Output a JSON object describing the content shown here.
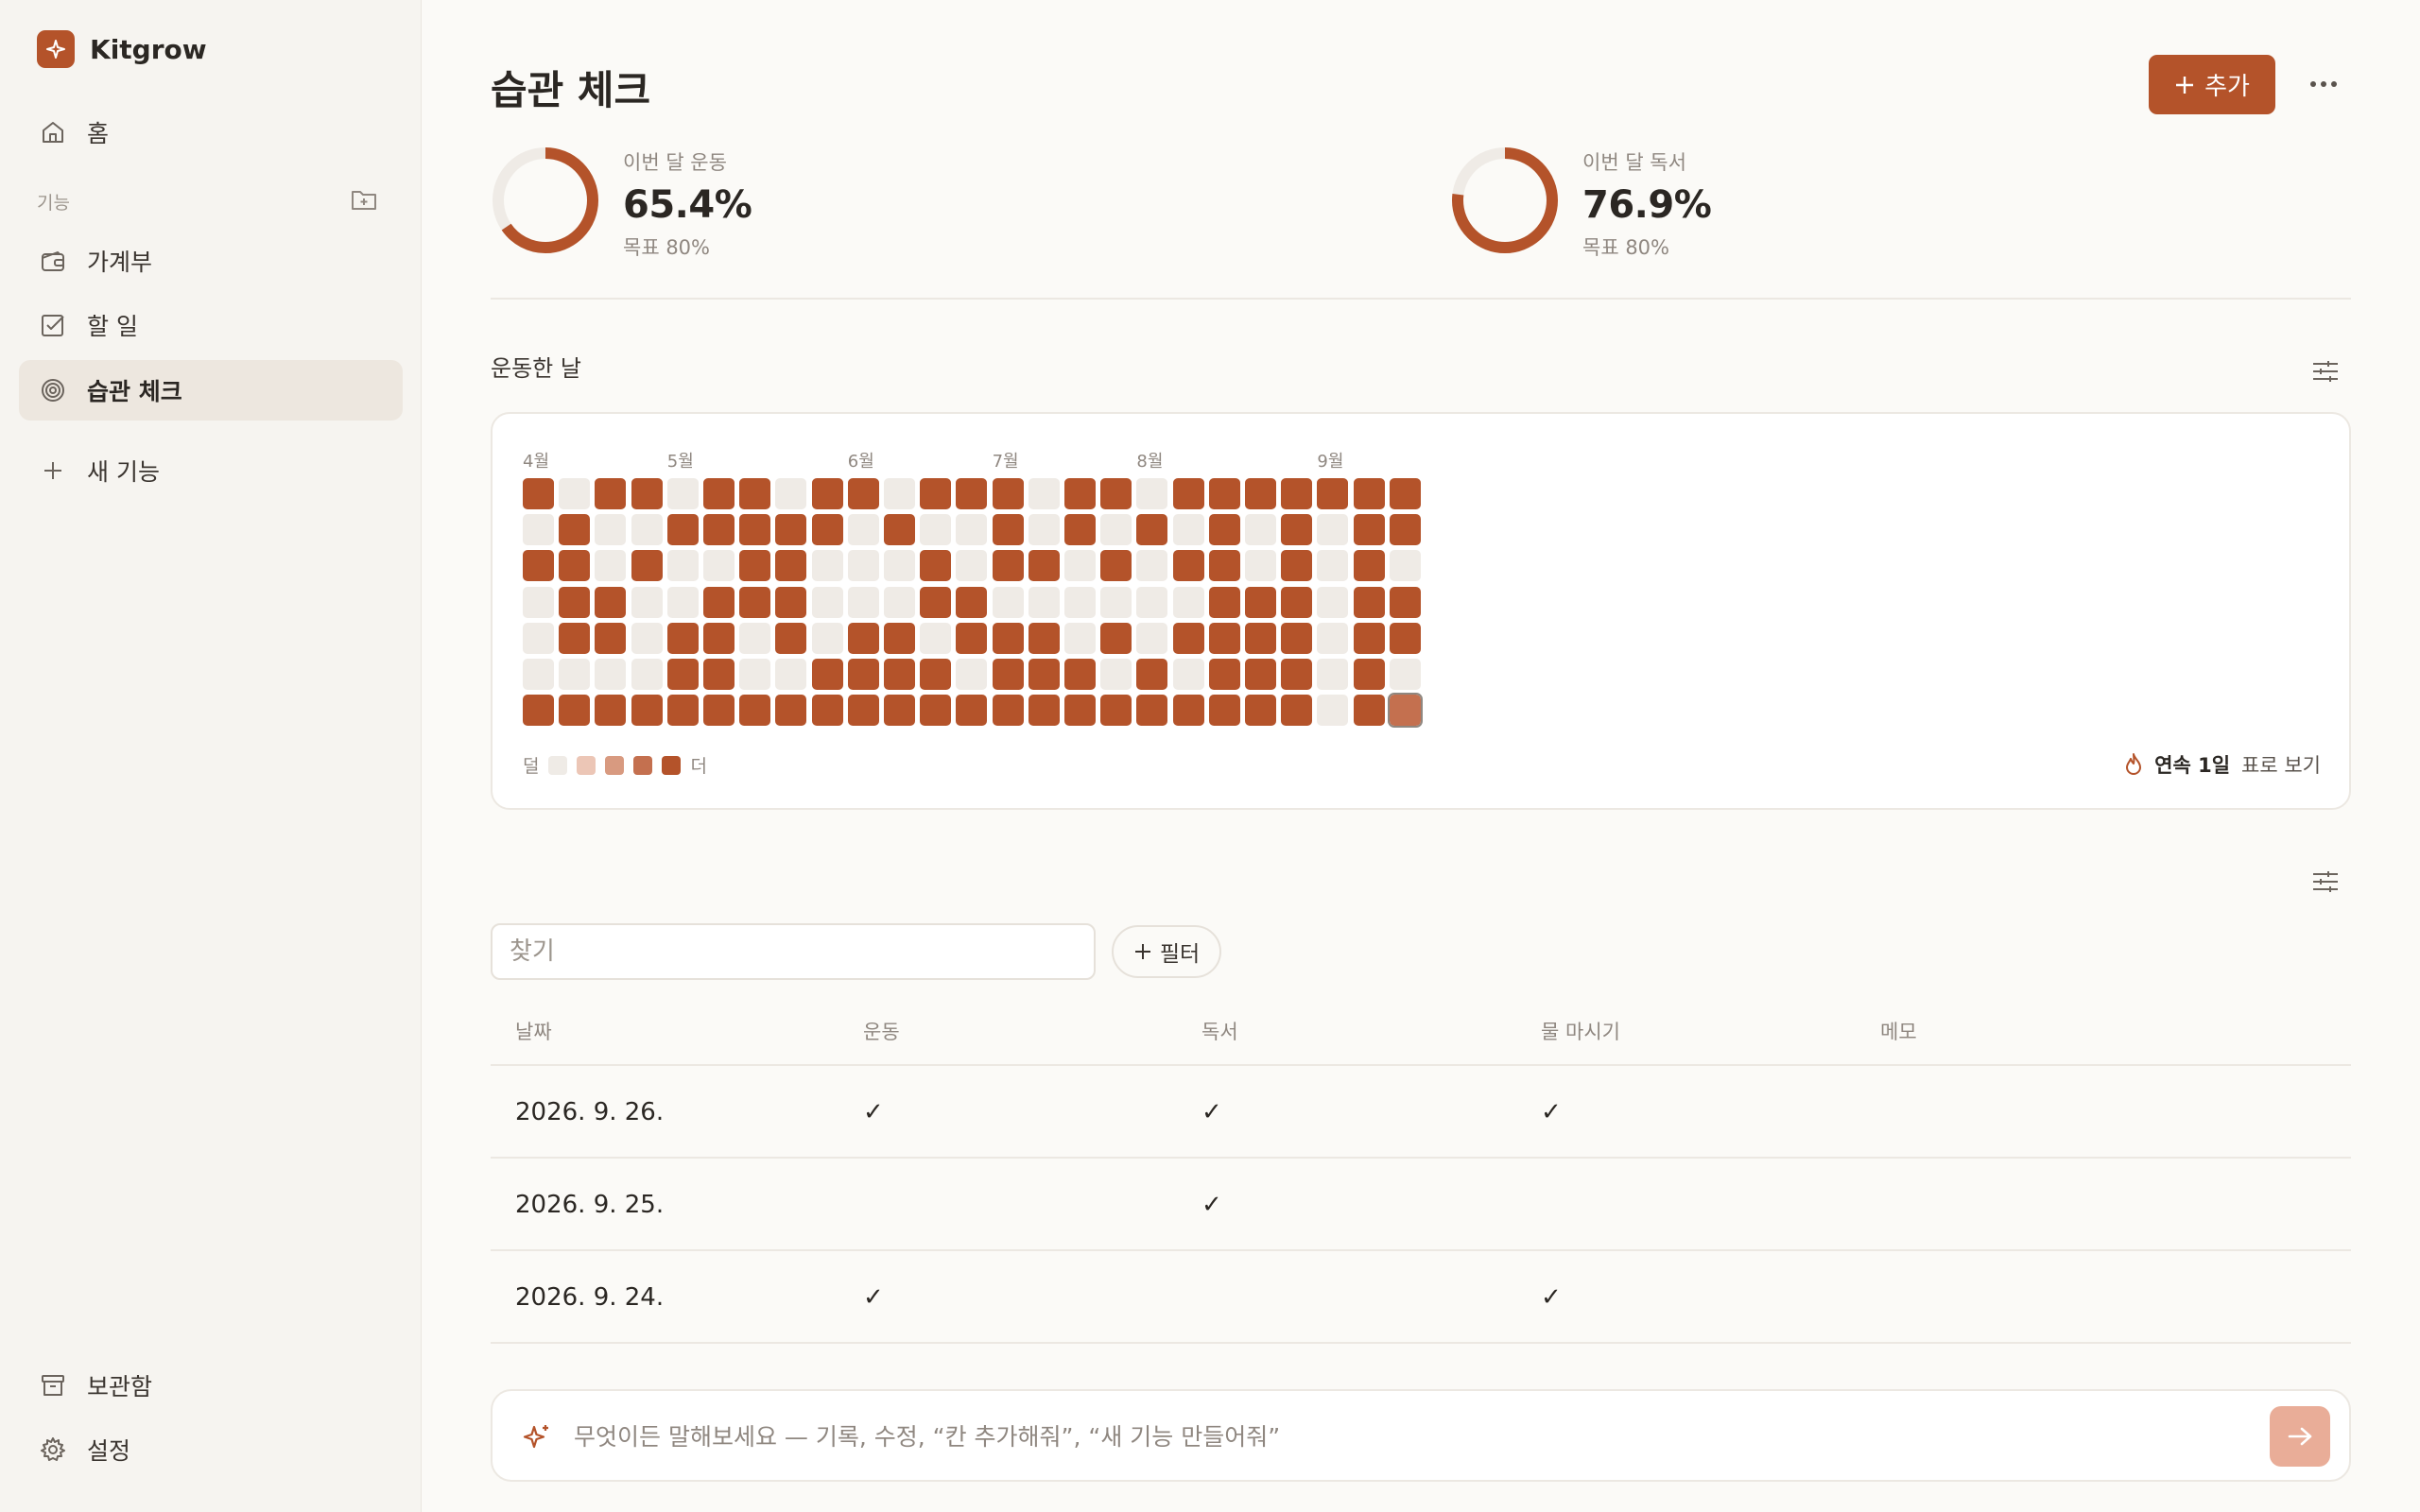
{
  "app": {
    "name": "Kitgrow"
  },
  "sidebar": {
    "home_label": "홈",
    "section_label": "기능",
    "items": [
      {
        "label": "가계부",
        "icon": "wallet-icon"
      },
      {
        "label": "할 일",
        "icon": "checkbox-icon"
      },
      {
        "label": "습관 체크",
        "icon": "target-icon",
        "active": true
      }
    ],
    "new_feature_label": "새 기능",
    "archive_label": "보관함",
    "settings_label": "설정"
  },
  "page": {
    "title": "습관 체크",
    "add_label": "추가"
  },
  "stats": [
    {
      "label": "이번 달 운동",
      "value": "65.4%",
      "target": "목표 80%",
      "fraction": 0.654
    },
    {
      "label": "이번 달 독서",
      "value": "76.9%",
      "target": "목표 80%",
      "fraction": 0.769
    }
  ],
  "heatmap": {
    "title": "운동한 날",
    "months": [
      {
        "label": "4월",
        "col": 0
      },
      {
        "label": "5월",
        "col": 4
      },
      {
        "label": "6월",
        "col": 9
      },
      {
        "label": "7월",
        "col": 13
      },
      {
        "label": "8월",
        "col": 17
      },
      {
        "label": "9월",
        "col": 22
      }
    ],
    "grid": [
      "1011011011011101101111111",
      "0100111110100101010101011",
      "1101001100010110101101010",
      "0110011100011000000111011",
      "0110110101101110101111011",
      "0000110011110111010111010",
      "1111111111111111111111011"
    ],
    "legend_less": "덜",
    "legend_more": "더",
    "legend_colors": [
      "#efebe6",
      "#ecc6b6",
      "#d89a80",
      "#c4704f",
      "#b4532a"
    ],
    "streak_label": "연속 1일",
    "table_view_label": "표로 보기"
  },
  "table": {
    "search_placeholder": "찾기",
    "filter_label": "필터",
    "columns": [
      "날짜",
      "운동",
      "독서",
      "물 마시기",
      "메모"
    ],
    "rows": [
      {
        "date": "2026. 9. 26.",
        "exercise": "✓",
        "reading": "✓",
        "water": "✓",
        "memo": ""
      },
      {
        "date": "2026. 9. 25.",
        "exercise": "",
        "reading": "✓",
        "water": "",
        "memo": ""
      },
      {
        "date": "2026. 9. 24.",
        "exercise": "✓",
        "reading": "",
        "water": "✓",
        "memo": ""
      }
    ]
  },
  "chat": {
    "placeholder": "무엇이든 말해보세요 — 기록, 수정, “칸 추가해줘”, “새 기능 만들어줘”"
  },
  "colors": {
    "accent": "#b4532a",
    "empty_cell": "#efebe6",
    "send_button": "#e9ad98"
  }
}
